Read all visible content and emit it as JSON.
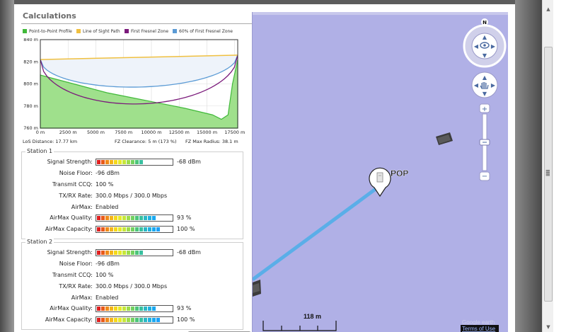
{
  "calculations": {
    "title": "Calculations"
  },
  "legend": [
    {
      "label": "Point-to-Point Profile",
      "color": "#41b93a"
    },
    {
      "label": "Line of Sight Path",
      "color": "#f0c040"
    },
    {
      "label": "First Fresnel Zone",
      "color": "#7b1a7b"
    },
    {
      "label": "60% of First Fresnel Zone",
      "color": "#5b9bd5"
    }
  ],
  "chart_data": {
    "type": "area",
    "xlabel": "",
    "ylabel": "",
    "x_ticks": [
      "0 m",
      "2500 m",
      "5000 m",
      "7500 m",
      "10000 m",
      "12500 m",
      "15000 m",
      "17500 m"
    ],
    "y_ticks": [
      "840 m",
      "820 m",
      "800 m",
      "780 m",
      "760 m"
    ],
    "xlim": [
      0,
      17770
    ],
    "ylim": [
      760,
      840
    ],
    "grid": true,
    "series": [
      {
        "name": "Point-to-Point Profile",
        "x": [
          0,
          1500,
          3000,
          4500,
          6000,
          8000,
          10500,
          13000,
          15500,
          16300,
          16900,
          17300,
          17770
        ],
        "y": [
          808,
          804,
          800,
          796,
          792,
          788,
          783,
          778,
          772,
          768,
          772,
          800,
          822
        ]
      },
      {
        "name": "Line of Sight Path",
        "x": [
          0,
          17770
        ],
        "y": [
          822,
          826
        ]
      }
    ]
  },
  "stats": {
    "los_distance": "LoS Distance:  17.77 km",
    "fz_clearance": "FZ Clearance:  5 m  (173 %)",
    "fz_max_radius": "FZ Max Radius:  38.1 m"
  },
  "stations": [
    {
      "title": "Station 1",
      "signal_strength_label": "Signal Strength:",
      "signal_strength_value": "-68 dBm",
      "signal_strength_level": 0.72,
      "noise_floor_label": "Noise Floor:",
      "noise_floor_value": "-96 dBm",
      "transmit_ccq_label": "Transmit CCQ:",
      "transmit_ccq_value": "100 %",
      "txrx_rate_label": "TX/RX Rate:",
      "txrx_rate_value": "300.0 Mbps / 300.0 Mbps",
      "airmax_label": "AirMax:",
      "airmax_value": "Enabled",
      "airmax_quality_label": "AirMax Quality:",
      "airmax_quality_value": "93 %",
      "airmax_quality_level": 0.93,
      "airmax_capacity_label": "AirMax Capacity:",
      "airmax_capacity_value": "100 %",
      "airmax_capacity_level": 1.0
    },
    {
      "title": "Station 2",
      "signal_strength_label": "Signal Strength:",
      "signal_strength_value": "-68 dBm",
      "signal_strength_level": 0.72,
      "noise_floor_label": "Noise Floor:",
      "noise_floor_value": "-96 dBm",
      "transmit_ccq_label": "Transmit CCQ:",
      "transmit_ccq_value": "100 %",
      "txrx_rate_label": "TX/RX Rate:",
      "txrx_rate_value": "300.0 Mbps / 300.0 Mbps",
      "airmax_label": "AirMax:",
      "airmax_value": "Enabled",
      "airmax_quality_label": "AirMax Quality:",
      "airmax_quality_value": "93 %",
      "airmax_quality_level": 0.93,
      "airmax_capacity_label": "AirMax Capacity:",
      "airmax_capacity_value": "100 %",
      "airmax_capacity_level": 1.0
    }
  ],
  "map": {
    "compass_label": "N",
    "marker_label": "POP",
    "scale_label": "118 m",
    "terms_label": "Terms of Use",
    "link_color": "#5aaee8",
    "background_color": "#b0b0e6"
  },
  "meter_colors": [
    "#e02020",
    "#e85a1a",
    "#f08a1a",
    "#f4b41a",
    "#f4d81a",
    "#e6ea2a",
    "#c6e63a",
    "#9ddc4a",
    "#74d060",
    "#4cc47a",
    "#3ac0a0",
    "#2ab8c4",
    "#20b0e0",
    "#1aa8f0",
    "#1aa0f8"
  ]
}
